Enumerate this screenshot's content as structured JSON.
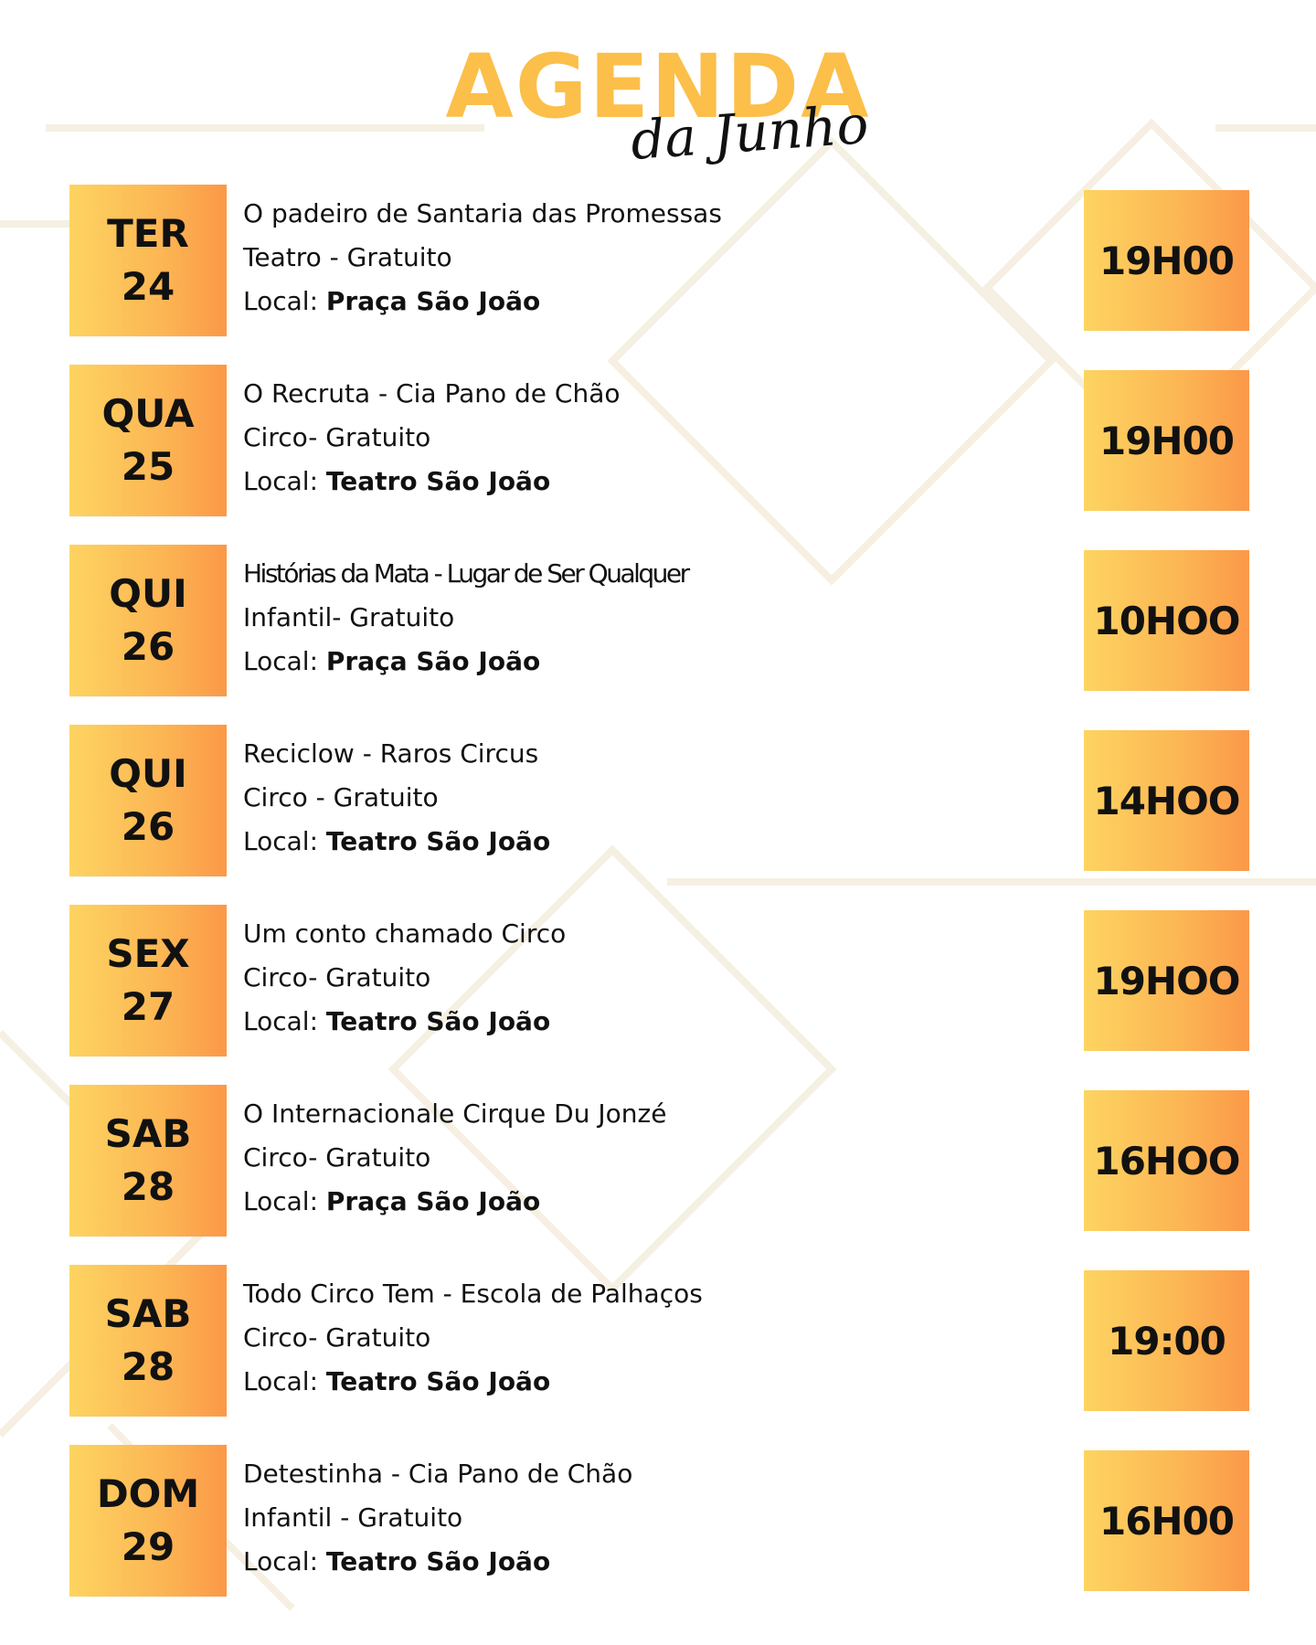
{
  "header": {
    "title": "AGENDA",
    "subtitle": "da Junho"
  },
  "colors": {
    "title_accent": "#fbbf4a",
    "box_gradient_start": "#fdd461",
    "box_gradient_end": "#fb9848",
    "text": "#111111",
    "background": "#ffffff",
    "decoration_lines": "#f6f0e2"
  },
  "events": [
    {
      "day": "TER",
      "date": "24",
      "title": "O padeiro de Santaria das Promessas",
      "category": "Teatro - Gratuito",
      "venue_label": "Local: ",
      "venue": "Praça São João",
      "time": "19H00"
    },
    {
      "day": "QUA",
      "date": "25",
      "title": "O Recruta - Cia Pano de Chão",
      "category": "Circo- Gratuito",
      "venue_label": "Local: ",
      "venue": "Teatro São João",
      "time": "19H00"
    },
    {
      "day": "QUI",
      "date": "26",
      "title": "Histórias da Mata - Lugar de Ser Qualquer",
      "category": "Infantil- Gratuito",
      "venue_label": "Local: ",
      "venue": "Praça São João",
      "time": "10HOO"
    },
    {
      "day": "QUI",
      "date": "26",
      "title": "Reciclow - Raros Circus",
      "category": "Circo - Gratuito",
      "venue_label": "Local: ",
      "venue": "Teatro São João",
      "time": "14HOO"
    },
    {
      "day": "SEX",
      "date": "27",
      "title": "Um conto chamado Circo",
      "category": "Circo- Gratuito",
      "venue_label": "Local: ",
      "venue": "Teatro São João",
      "time": "19HOO"
    },
    {
      "day": "SAB",
      "date": "28",
      "title": "O Internacionale Cirque Du Jonzé",
      "category": "Circo- Gratuito",
      "venue_label": "Local: ",
      "venue": "Praça São João",
      "time": "16HOO"
    },
    {
      "day": "SAB",
      "date": "28",
      "title": "Todo Circo Tem - Escola de Palhaços",
      "category": "Circo- Gratuito",
      "venue_label": "Local: ",
      "venue": "Teatro São João",
      "time": "19:00"
    },
    {
      "day": "DOM",
      "date": "29",
      "title": "Detestinha - Cia Pano de Chão",
      "category": "Infantil - Gratuito",
      "venue_label": "Local: ",
      "venue": "Teatro São João",
      "time": "16H00"
    }
  ]
}
